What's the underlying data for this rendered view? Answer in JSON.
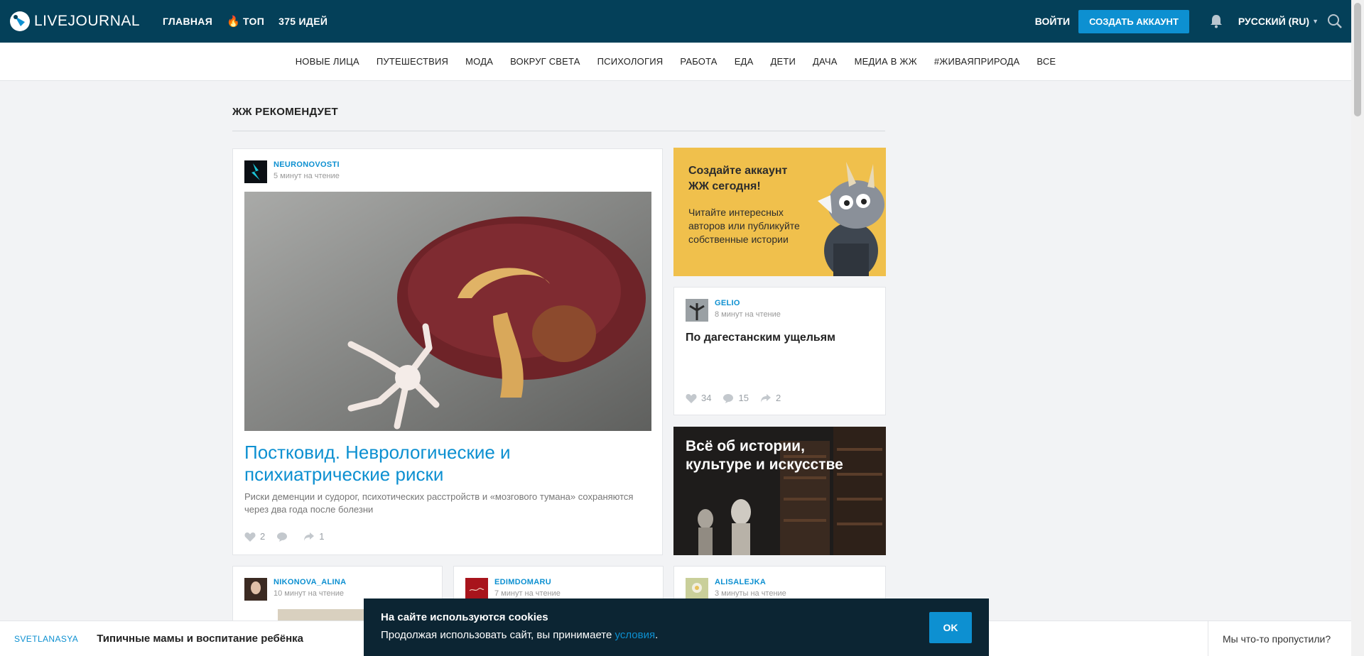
{
  "header": {
    "logo_text": "LIVEJOURNAL",
    "nav": [
      {
        "label": "ГЛАВНАЯ"
      },
      {
        "label": "ТОП",
        "icon": "flame-icon"
      },
      {
        "label": "375 ИДЕЙ"
      }
    ],
    "login_label": "ВОЙТИ",
    "create_account_label": "СОЗДАТЬ АККАУНТ",
    "language_label": "РУССКИЙ (RU)"
  },
  "categories": [
    "НОВЫЕ ЛИЦА",
    "ПУТЕШЕСТВИЯ",
    "МОДА",
    "ВОКРУГ СВЕТА",
    "ПСИХОЛОГИЯ",
    "РАБОТА",
    "ЕДА",
    "ДЕТИ",
    "ДАЧА",
    "МЕДИА В ЖЖ",
    "#ЖИВАЯПРИРОДА",
    "ВСЕ"
  ],
  "section": {
    "title": "ЖЖ РЕКОМЕНДУЕТ"
  },
  "main_post": {
    "author": "NEURONOVOSTI",
    "read_time": "5 минут на чтение",
    "title": "Постковид. Неврологические и психиатрические риски",
    "lead": "Риски деменции и судорог, психотических расстройств и «мозгового тумана» сохраняются через два года после болезни",
    "likes": "2",
    "comments": "",
    "reposts": "1"
  },
  "promo": {
    "title": "Создайте аккаунт ЖЖ сегодня!",
    "text": "Читайте интересных авторов или публикуйте собственные истории"
  },
  "side_post": {
    "author": "GELIO",
    "read_time": "8 минут на чтение",
    "title": "По дагестанским ущельям",
    "likes": "34",
    "comments": "15",
    "reposts": "2"
  },
  "feature": {
    "title": "Всё об истории, культуре и искусстве"
  },
  "row_posts": [
    {
      "author": "NIKONOVA_ALINA",
      "read_time": "10 минут на чтение"
    },
    {
      "author": "EDIMDOMARU",
      "read_time": "7 минут на чтение"
    },
    {
      "author": "ALISALEJKA",
      "read_time": "3 минуты на чтение"
    }
  ],
  "bottom_strip": {
    "author": "SVETLANASYA",
    "title": "Типичные мамы и воспитание ребёнка",
    "right_label": "Мы что-то пропустили?"
  },
  "cookie": {
    "title": "На сайте используются cookies",
    "text_before": "Продолжая использовать сайт, вы принимаете ",
    "link": "условия",
    "text_after": ".",
    "ok_label": "OK"
  },
  "colors": {
    "header_bg": "#044059",
    "accent": "#0d90d1",
    "promo_bg": "#f0c04c",
    "cookie_bg": "#0c2533"
  }
}
